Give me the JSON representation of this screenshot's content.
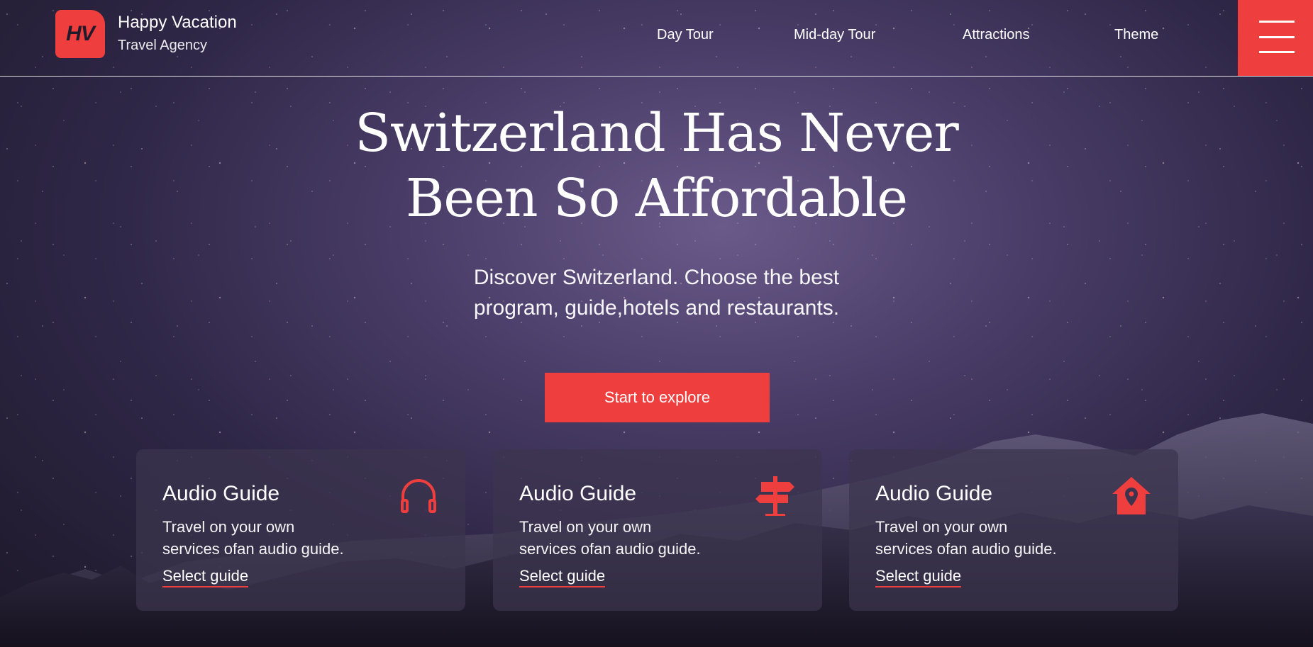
{
  "brand": {
    "logo_text": "HV",
    "name": "Happy Vacation",
    "tagline": "Travel Agency"
  },
  "nav": [
    "Day Tour",
    "Mid-day Tour",
    "Attractions",
    "Theme"
  ],
  "hero": {
    "title_line1": "Switzerland Has Never",
    "title_line2": "Been So Affordable",
    "subtitle_line1": "Discover Switzerland. Choose the best",
    "subtitle_line2": "program, guide,hotels and restaurants.",
    "cta_label": "Start to explore"
  },
  "cards": [
    {
      "title": "Audio Guide",
      "text_line1": "Travel on your own",
      "text_line2": "services ofan audio guide.",
      "link": "Select guide",
      "icon": "headphones-icon"
    },
    {
      "title": "Audio Guide",
      "text_line1": "Travel on your own",
      "text_line2": "services ofan audio guide.",
      "link": "Select guide",
      "icon": "signpost-icon"
    },
    {
      "title": "Audio Guide",
      "text_line1": "Travel on your own",
      "text_line2": "services ofan audio guide.",
      "link": "Select guide",
      "icon": "home-location-icon"
    }
  ],
  "colors": {
    "accent": "#ef3e3e",
    "background": "#2f2747"
  }
}
